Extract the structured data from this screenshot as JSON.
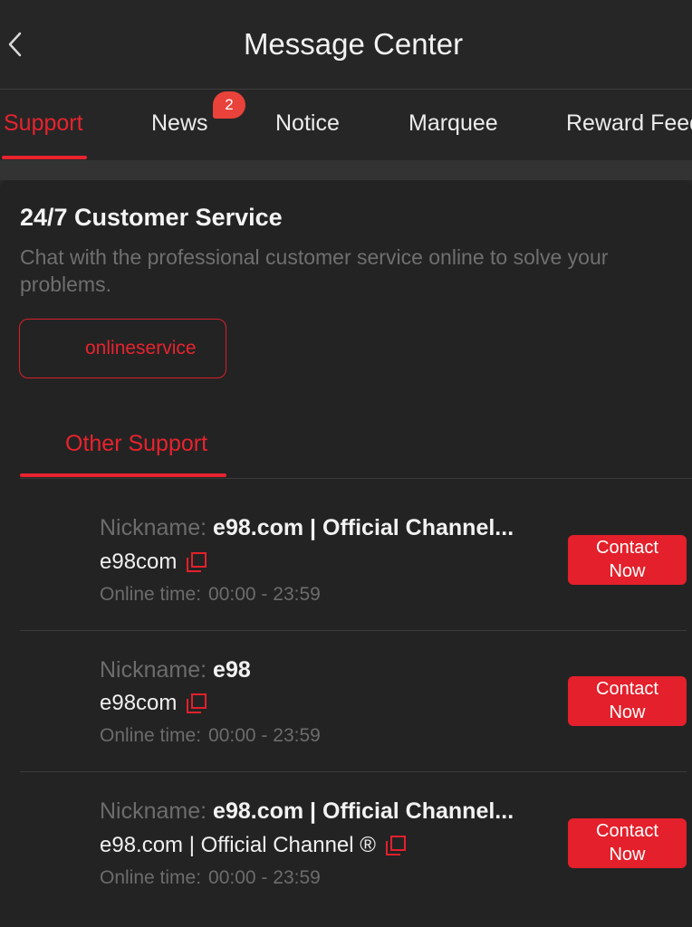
{
  "header": {
    "title": "Message Center",
    "back_icon": "chevron-left-icon"
  },
  "tabs": [
    {
      "label": "Support",
      "active": true
    },
    {
      "label": "News",
      "badge": "2"
    },
    {
      "label": "Notice"
    },
    {
      "label": "Marquee"
    },
    {
      "label": "Reward Feed"
    }
  ],
  "customer_service": {
    "title": "24/7 Customer Service",
    "description": "Chat with the professional customer service online to solve your problems.",
    "button_label": "onlineservice"
  },
  "other_support": {
    "tab_label": "Other Support",
    "items": [
      {
        "nickname_label": "Nickname:",
        "nickname": "e98.com | Official Channel...",
        "account": "e98com",
        "online_label": "Online time:",
        "online_time": "00:00 - 23:59",
        "button_line1": "Contact",
        "button_line2": "Now"
      },
      {
        "nickname_label": "Nickname:",
        "nickname": "e98",
        "account": "e98com",
        "online_label": "Online time:",
        "online_time": "00:00 - 23:59",
        "button_line1": "Contact",
        "button_line2": "Now"
      },
      {
        "nickname_label": "Nickname:",
        "nickname": "e98.com | Official Channel...",
        "account": "e98.com | Official Channel ®",
        "online_label": "Online time:",
        "online_time": "00:00 - 23:59",
        "button_line1": "Contact",
        "button_line2": "Now"
      }
    ]
  },
  "colors": {
    "accent": "#e8232e",
    "background": "#232323",
    "muted_text": "#6c6c6c"
  },
  "icons": {
    "copy": "copy-icon"
  }
}
